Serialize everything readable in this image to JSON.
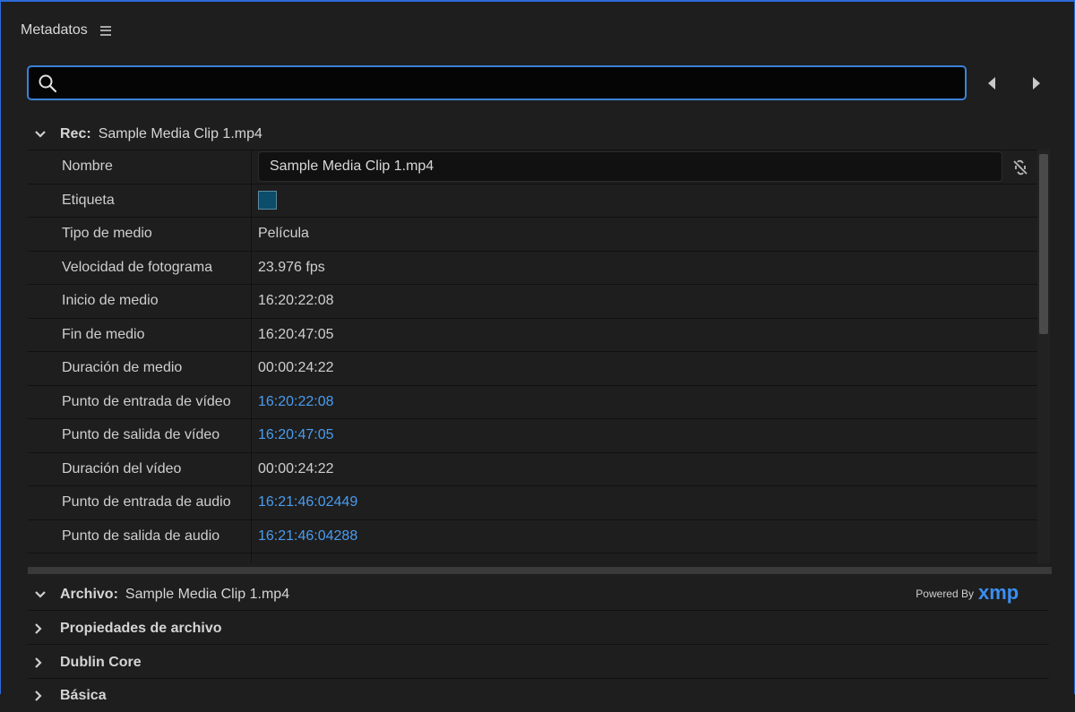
{
  "panel": {
    "title": "Metadatos",
    "menu_icon": "hamburger-menu-icon"
  },
  "search": {
    "value": "",
    "placeholder": "",
    "icon": "search-icon"
  },
  "nav": {
    "prev_icon": "triangle-left-icon",
    "next_icon": "triangle-right-icon"
  },
  "rec": {
    "key": "Rec:",
    "name": "Sample Media Clip 1.mp4",
    "rows": [
      {
        "label": "Nombre",
        "value": "Sample Media Clip 1.mp4"
      },
      {
        "label": "Etiqueta",
        "value": "",
        "swatch_color": "#0b4d6a"
      },
      {
        "label": "Tipo de medio",
        "value": "Película"
      },
      {
        "label": "Velocidad de fotograma",
        "value": "23.976 fps"
      },
      {
        "label": "Inicio de medio",
        "value": "16:20:22:08"
      },
      {
        "label": "Fin de medio",
        "value": "16:20:47:05"
      },
      {
        "label": "Duración de medio",
        "value": "00:00:24:22"
      },
      {
        "label": "Punto de entrada de vídeo",
        "value": "16:20:22:08"
      },
      {
        "label": "Punto de salida de vídeo",
        "value": "16:20:47:05"
      },
      {
        "label": "Duración del vídeo",
        "value": "00:00:24:22"
      },
      {
        "label": "Punto de entrada de audio",
        "value": "16:21:46:02449"
      },
      {
        "label": "Punto de salida de audio",
        "value": "16:21:46:04288"
      }
    ]
  },
  "archivo": {
    "key": "Archivo:",
    "name": "Sample Media Clip 1.mp4",
    "powered_by": "Powered By",
    "xmp": "xmp"
  },
  "sections": {
    "propiedades": "Propiedades de archivo",
    "dublin": "Dublin Core",
    "basica": "Básica"
  },
  "colors": {
    "accent": "#3b82d6",
    "link": "#4a9cf0",
    "background": "#1e1e1e"
  }
}
